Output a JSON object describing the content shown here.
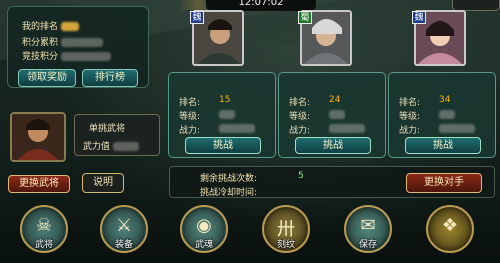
{
  "clock": "12:07:02",
  "rank_panel": {
    "rank_label": "我的排名",
    "points_label": "积分累积",
    "arena_points_label": "竞技积分",
    "claim_reward_button": "领取奖励",
    "leaderboard_button": "排行榜"
  },
  "general": {
    "duel_general_label": "单挑武将",
    "power_label": "武力值",
    "change_general_button": "更换武将",
    "help_button": "说明"
  },
  "opponents": [
    {
      "kingdom": "魏",
      "kingdom_color": "#1f3d8b",
      "rank_label": "排名:",
      "rank_value": "15",
      "level_label": "等级:",
      "power_label": "战力:",
      "challenge_button": "挑战"
    },
    {
      "kingdom": "蜀",
      "kingdom_color": "#1f7a2a",
      "rank_label": "排名:",
      "rank_value": "24",
      "level_label": "等级:",
      "power_label": "战力:",
      "challenge_button": "挑战"
    },
    {
      "kingdom": "魏",
      "kingdom_color": "#1f3d8b",
      "rank_label": "排名:",
      "rank_value": "34",
      "level_label": "等级:",
      "power_label": "战力:",
      "challenge_button": "挑战"
    }
  ],
  "remaining": {
    "challenges_left_label": "剩余挑战次数:",
    "challenges_left_value": "5",
    "cooldown_label": "挑战冷却时间:",
    "change_opponent_button": "更换对手"
  },
  "bottom_nav": [
    {
      "label": "武将",
      "glyph": "☠",
      "icon": "general-icon",
      "bg": "#365e59"
    },
    {
      "label": "装备",
      "glyph": "⚔",
      "icon": "equipment-icon",
      "bg": "#3b6560"
    },
    {
      "label": "武魂",
      "glyph": "◉",
      "icon": "soul-icon",
      "bg": "#3d6b63"
    },
    {
      "label": "刻纹",
      "glyph": "卅",
      "icon": "engrave-icon",
      "bg": "#5a4e24"
    },
    {
      "label": "保存",
      "glyph": "✉",
      "icon": "save-icon",
      "bg": "#3d6860"
    },
    {
      "label": "",
      "glyph": "❖",
      "icon": "coin-icon",
      "bg": "#675820"
    }
  ]
}
